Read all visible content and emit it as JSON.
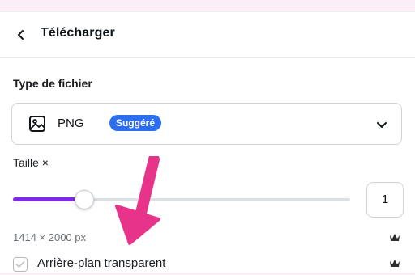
{
  "header": {
    "title": "Télécharger",
    "back_icon": "chevron-left-icon"
  },
  "filetype": {
    "section_label": "Type de fichier",
    "selected": "PNG",
    "badge": "Suggéré",
    "icon": "image-icon",
    "dropdown_icon": "chevron-down-icon"
  },
  "size": {
    "label": "Taille ×",
    "value": "1",
    "slider_fraction": 0.21,
    "dimensions": "1414 × 2000 px",
    "premium_icon": "crown-icon"
  },
  "transparent": {
    "label": "Arrière-plan transparent",
    "checked": false,
    "premium_icon": "crown-icon"
  },
  "annotation": {
    "icon": "arrow-down-icon",
    "color": "#e8338b"
  },
  "colors": {
    "accent": "#7d2ae8",
    "badge": "#2b6ef0",
    "background": "#fbeef7"
  }
}
